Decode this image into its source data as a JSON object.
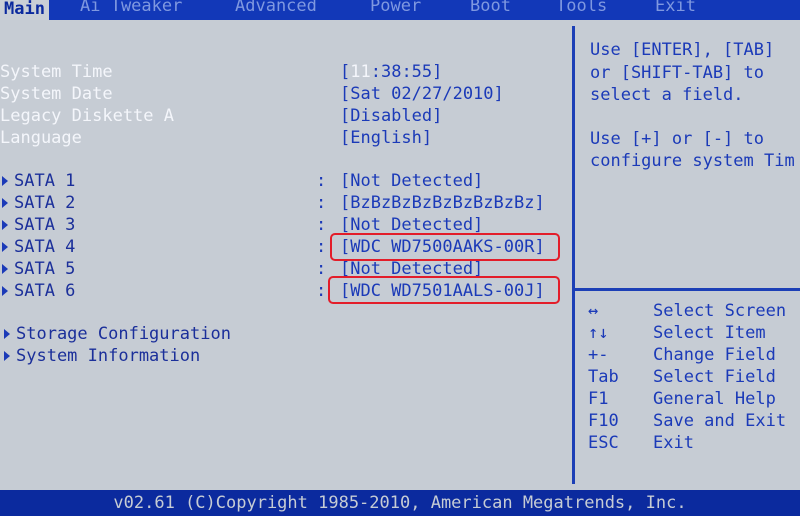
{
  "menu": {
    "tabs": [
      "Main",
      "Ai Tweaker",
      "Advanced",
      "Power",
      "Boot",
      "Tools",
      "Exit"
    ]
  },
  "settings": [
    {
      "label": "System Time",
      "value_prefix": "[",
      "value_hl": "11",
      "value_rest": ":38:55]"
    },
    {
      "label": "System Date",
      "value": "[Sat 02/27/2010]"
    },
    {
      "label": "Legacy Diskette A",
      "value": "[Disabled]"
    },
    {
      "label": "Language",
      "value": "[English]"
    }
  ],
  "sata": [
    {
      "label": "SATA 1",
      "value": "[Not Detected]"
    },
    {
      "label": "SATA 2",
      "value": "[BzBzBzBzBzBzBzBzBz]"
    },
    {
      "label": "SATA 3",
      "value": "[Not Detected]"
    },
    {
      "label": "SATA 4",
      "value": "[WDC WD7500AAKS-00R]"
    },
    {
      "label": "SATA 5",
      "value": "[Not Detected]"
    },
    {
      "label": "SATA 6",
      "value": "[WDC WD7501AALS-00J]"
    }
  ],
  "colon": ":",
  "submenus": [
    "Storage Configuration",
    "System Information"
  ],
  "help": {
    "line1": "Use [ENTER], [TAB]",
    "line2": "or [SHIFT-TAB] to",
    "line3": "select a field.",
    "line4": "Use [+] or [-] to",
    "line5": "configure system Tim"
  },
  "keys": [
    {
      "key": "↔",
      "desc": "Select Screen"
    },
    {
      "key": "↑↓",
      "desc": "Select Item"
    },
    {
      "key": "+-",
      "desc": "Change Field"
    },
    {
      "key": "Tab",
      "desc": "Select Field"
    },
    {
      "key": "F1",
      "desc": "General Help"
    },
    {
      "key": "F10",
      "desc": "Save and Exit"
    },
    {
      "key": "ESC",
      "desc": "Exit"
    }
  ],
  "footer": "v02.61 (C)Copyright 1985-2010, American Megatrends, Inc.",
  "colors": {
    "background": "#0b2a9e",
    "panel": "#c6ccd4",
    "highlight_box": "#e31d2a"
  }
}
